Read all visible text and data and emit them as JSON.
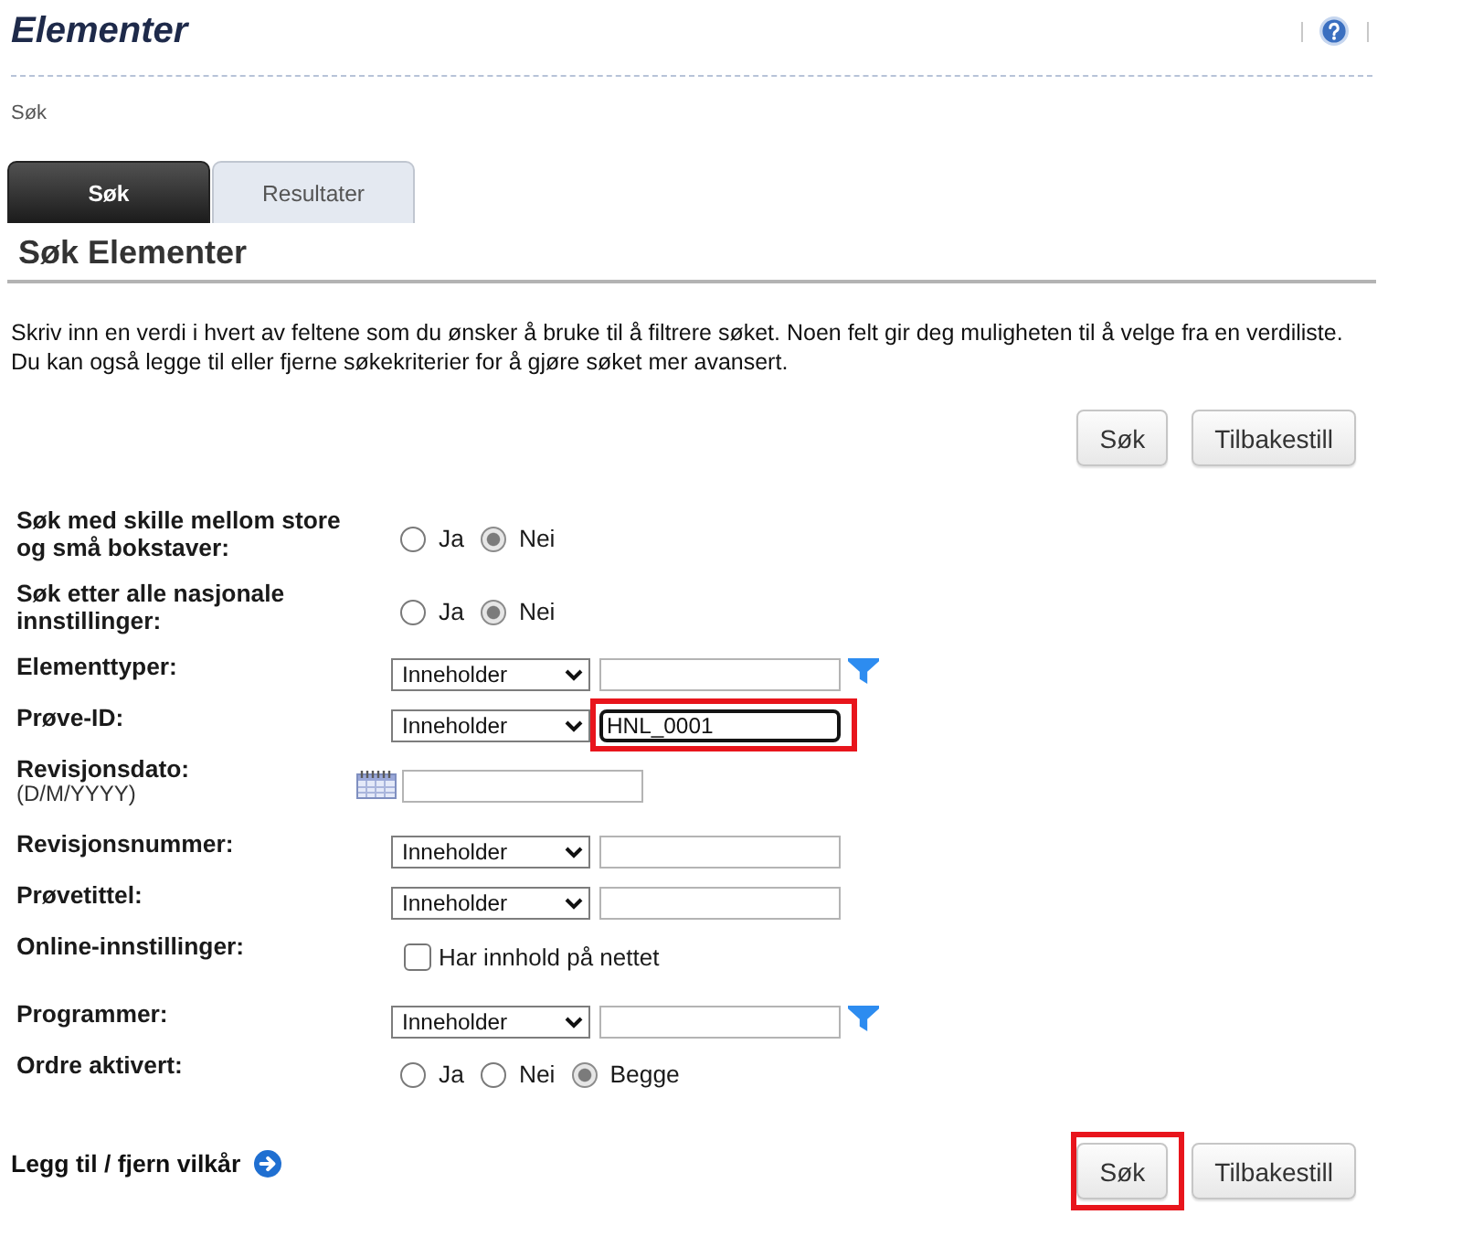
{
  "page": {
    "title": "Elementer",
    "breadcrumb": "Søk"
  },
  "tabs": [
    {
      "label": "Søk",
      "selected": true
    },
    {
      "label": "Resultater",
      "selected": false
    }
  ],
  "section": {
    "heading": "Søk Elementer",
    "intro": "Skriv inn en verdi i hvert av feltene som du ønsker å bruke til å filtrere søket. Noen felt gir deg muligheten til å velge fra en verdiliste. Du kan også legge til eller fjerne søkekriterier for å gjøre søket mer avansert."
  },
  "top_buttons": [
    {
      "label": "Søk",
      "highlighted": false
    },
    {
      "label": "Tilbakestill",
      "highlighted": false
    }
  ],
  "criteria": [
    {
      "kind": "radio",
      "label": "Søk med skille mellom store og små bokstaver:",
      "options": [
        {
          "label": "Ja",
          "selected": false
        },
        {
          "label": "Nei",
          "selected": true
        }
      ]
    },
    {
      "kind": "radio",
      "label": "Søk etter alle nasjonale innstillinger:",
      "options": [
        {
          "label": "Ja",
          "selected": false
        },
        {
          "label": "Nei",
          "selected": true
        }
      ]
    },
    {
      "kind": "match",
      "label": "Elementtyper:",
      "operator": "Inneholder",
      "focused": false,
      "highlighted": false,
      "lookup": true
    },
    {
      "kind": "match",
      "label": "Prøve-ID:",
      "operator": "Inneholder",
      "value": "HNL_0001",
      "focused": true,
      "highlighted": true,
      "lookup": false
    },
    {
      "kind": "date",
      "label": "Revisjonsdato:",
      "hint": "(D/M/YYYY)"
    },
    {
      "kind": "match",
      "label": "Revisjonsnummer:",
      "operator": "Inneholder",
      "focused": false,
      "highlighted": false,
      "lookup": false
    },
    {
      "kind": "match",
      "label": "Prøvetittel:",
      "operator": "Inneholder",
      "focused": false,
      "highlighted": false,
      "lookup": false
    },
    {
      "kind": "checkbox",
      "label": "Online-innstillinger:",
      "option": "Har innhold på nettet",
      "checked": false
    },
    {
      "kind": "match",
      "label": "Programmer:",
      "operator": "Inneholder",
      "focused": false,
      "highlighted": false,
      "lookup": true
    },
    {
      "kind": "radio",
      "label": "Ordre aktivert:",
      "options": [
        {
          "label": "Ja",
          "selected": false
        },
        {
          "label": "Nei",
          "selected": false
        },
        {
          "label": "Begge",
          "selected": true
        }
      ]
    }
  ],
  "footer": {
    "link": "Legg til / fjern vilkår"
  },
  "bottom_buttons": [
    {
      "label": "Søk",
      "highlighted": true
    },
    {
      "label": "Tilbakestill",
      "highlighted": false
    }
  ]
}
